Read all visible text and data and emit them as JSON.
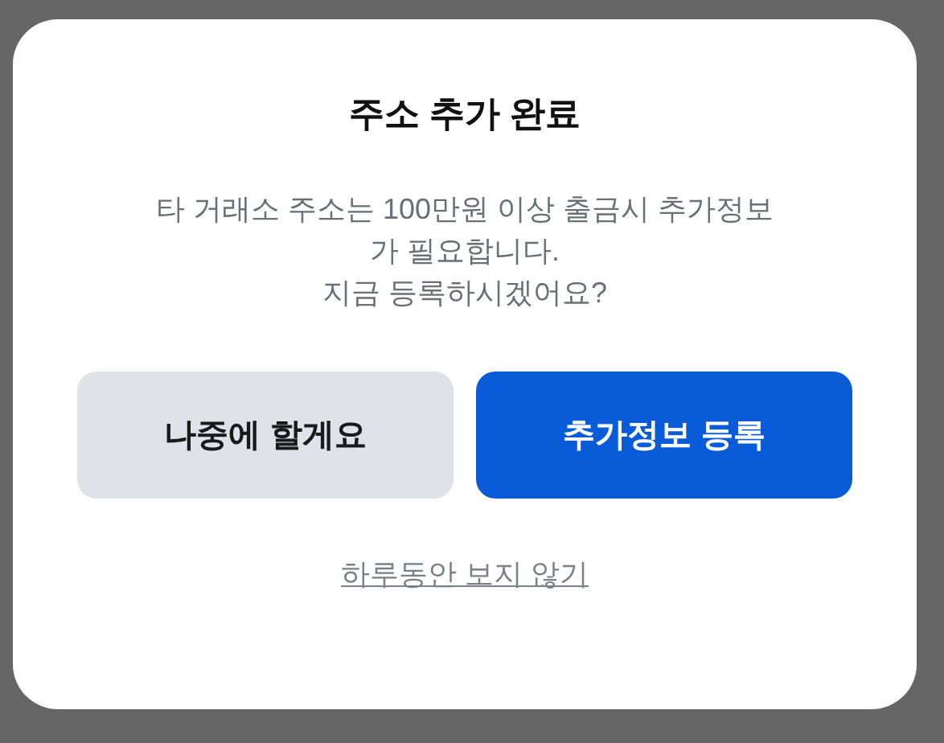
{
  "dialog": {
    "title": "주소 추가 완료",
    "message_lines": [
      "타 거래소 주소는 100만원 이상 출금시 추가정보",
      "가 필요합니다.",
      "지금 등록하시겠어요?"
    ],
    "buttons": [
      {
        "label": "나중에 할게요",
        "kind": "secondary"
      },
      {
        "label": "추가정보 등록",
        "kind": "primary"
      }
    ],
    "link": "하루동안 보지 않기"
  }
}
